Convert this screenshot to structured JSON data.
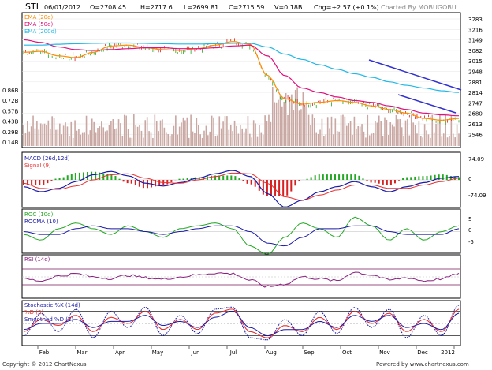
{
  "header": {
    "symbol": "STI",
    "date": "06/01/2012",
    "open": "O=2708.45",
    "high": "H=2717.6",
    "low": "L=2699.81",
    "close": "C=2715.59",
    "volume": "V=0.18B",
    "change": "Chg=+2.57 (+0.1%)",
    "credit": "Charted By MOBUGOBU"
  },
  "footer": {
    "copyright": "Copyright © 2012 ChartNexus",
    "powered": "Powered by www.chartnexus.com"
  },
  "colors": {
    "ema20": "#ff8c00",
    "ema50": "#e0107d",
    "ema200": "#20b8e8",
    "macd": "#1a1aa8",
    "signal": "#e83030",
    "roc": "#22a822",
    "rocma": "#1a1aa8",
    "rsi": "#8a2080",
    "stoch_k": "#1a1aa8",
    "stoch_d": "#e83030",
    "stoch_sd": "#1a1aa8",
    "trend": "#3030d0",
    "up": "#22a822",
    "down": "#d82020",
    "volume": "#c9a7a2"
  },
  "chart_data": [
    {
      "type": "line",
      "title": "STI",
      "ylim": [
        2546,
        3283
      ],
      "y_ticks": [
        "3283",
        "3216",
        "3149",
        "3082",
        "3015",
        "2948",
        "2881",
        "2814",
        "2747",
        "2680",
        "2613",
        "2546"
      ],
      "volume_ticks": [
        "0.86B",
        "0.72B",
        "0.57B",
        "0.43B",
        "0.29B",
        "0.14B"
      ],
      "x_ticks": [
        "Feb",
        "Mar",
        "Apr",
        "May",
        "Jun",
        "Jul",
        "Aug",
        "Sep",
        "Oct",
        "Nov",
        "Dec",
        "2012"
      ],
      "series": [
        {
          "name": "EMA (20d)",
          "values": [
            3070,
            3075,
            3050,
            3040,
            3070,
            3105,
            3110,
            3095,
            3085,
            3080,
            3090,
            3110,
            3130,
            3115,
            2940,
            2810,
            2780,
            2790,
            2800,
            2790,
            2770,
            2750,
            2730,
            2700,
            2690,
            2700
          ]
        },
        {
          "name": "EMA (50d)",
          "values": [
            3140,
            3125,
            3100,
            3085,
            3080,
            3085,
            3090,
            3095,
            3095,
            3090,
            3090,
            3095,
            3105,
            3110,
            3050,
            2940,
            2870,
            2845,
            2820,
            2800,
            2790,
            2770,
            2750,
            2730,
            2720,
            2715
          ]
        },
        {
          "name": "EMA (200d)",
          "values": [
            3110,
            3110,
            3115,
            3118,
            3120,
            3122,
            3122,
            3120,
            3118,
            3116,
            3116,
            3118,
            3120,
            3120,
            3100,
            3060,
            3030,
            3000,
            2975,
            2950,
            2930,
            2905,
            2885,
            2870,
            2855,
            2845
          ]
        }
      ]
    },
    {
      "type": "line",
      "title": "MACD (26d,12d)",
      "ylim": [
        -74.09,
        74.09
      ],
      "y_ticks": [
        "74.09",
        "0",
        "-74.09"
      ],
      "series": [
        {
          "name": "MACD (26d,12d)",
          "values": [
            -20,
            -35,
            -25,
            -5,
            15,
            25,
            12,
            -10,
            -18,
            -8,
            5,
            18,
            28,
            10,
            -40,
            -80,
            -60,
            -35,
            -20,
            -5,
            -20,
            -35,
            -20,
            -8,
            5,
            10
          ]
        },
        {
          "name": "Signal (9)",
          "values": [
            -10,
            -25,
            -28,
            -18,
            0,
            15,
            18,
            5,
            -8,
            -10,
            0,
            10,
            20,
            18,
            -10,
            -50,
            -60,
            -45,
            -30,
            -15,
            -15,
            -25,
            -25,
            -15,
            -5,
            5
          ]
        }
      ]
    },
    {
      "type": "line",
      "title": "ROC (10d)",
      "ylim": [
        -7,
        7
      ],
      "y_ticks": [
        "5",
        "0",
        "-5"
      ],
      "series": [
        {
          "name": "ROC (10d)",
          "values": [
            -1,
            -3,
            1,
            3,
            1,
            -1,
            2,
            0,
            -2,
            1,
            2,
            3,
            1,
            -5,
            -8,
            -2,
            3,
            1,
            -2,
            5,
            2,
            -3,
            1,
            -3,
            0,
            2
          ]
        },
        {
          "name": "ROCMA (10)",
          "values": [
            0,
            -1,
            -1,
            1,
            2,
            1,
            1,
            0,
            -1,
            0,
            1,
            2,
            2,
            0,
            -4,
            -5,
            -2,
            1,
            1,
            2,
            2,
            0,
            -1,
            -1,
            -1,
            1
          ]
        }
      ]
    },
    {
      "type": "line",
      "title": "RSI (14d)",
      "ylim": [
        0,
        100
      ],
      "series": [
        {
          "name": "RSI (14d)",
          "values": [
            45,
            40,
            52,
            58,
            50,
            46,
            54,
            48,
            44,
            50,
            55,
            60,
            58,
            42,
            25,
            32,
            50,
            45,
            40,
            62,
            55,
            42,
            48,
            40,
            45,
            58
          ]
        }
      ]
    },
    {
      "type": "line",
      "title": "Stochastic %K (14d)",
      "ylim": [
        0,
        100
      ],
      "series": [
        {
          "name": "Stochastic %K (14d)",
          "values": [
            20,
            75,
            30,
            85,
            15,
            80,
            40,
            90,
            20,
            70,
            25,
            85,
            90,
            15,
            10,
            60,
            20,
            80,
            25,
            90,
            40,
            85,
            15,
            70,
            20,
            95
          ]
        },
        {
          "name": "%D (3)",
          "values": [
            30,
            60,
            45,
            70,
            30,
            65,
            50,
            80,
            35,
            60,
            35,
            75,
            85,
            30,
            15,
            45,
            30,
            65,
            35,
            80,
            50,
            75,
            30,
            60,
            30,
            85
          ]
        },
        {
          "name": "Smoothed %D (3)",
          "values": [
            35,
            50,
            50,
            60,
            40,
            55,
            55,
            70,
            45,
            55,
            40,
            65,
            80,
            40,
            20,
            35,
            35,
            55,
            40,
            70,
            55,
            70,
            40,
            50,
            35,
            75
          ]
        }
      ]
    }
  ],
  "labels": {
    "ema20": "EMA (20d)",
    "ema50": "EMA (50d)",
    "ema200": "EMA (200d)",
    "macd": "MACD (26d,12d)",
    "signal": "Signal (9)",
    "roc": "ROC (10d)",
    "rocma": "ROCMA (10)",
    "rsi": "RSI (14d)",
    "stoch_k": "Stochastic %K (14d)",
    "stoch_d": "%D (3)",
    "stoch_sd": "Smoothed %D (3)"
  }
}
